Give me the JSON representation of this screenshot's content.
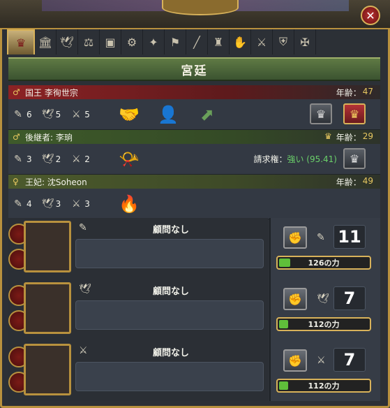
{
  "window": {
    "title": "宮廷",
    "close_icon": "close-icon"
  },
  "tabs": [
    {
      "icon": "crown-icon",
      "active": true
    },
    {
      "icon": "temple-icon"
    },
    {
      "icon": "dove-icon"
    },
    {
      "icon": "goods-icon"
    },
    {
      "icon": "trade-icon"
    },
    {
      "icon": "gears-icon"
    },
    {
      "icon": "idea-bulb-icon"
    },
    {
      "icon": "flag-icon"
    },
    {
      "icon": "rifle-icon"
    },
    {
      "icon": "estates-icon"
    },
    {
      "icon": "prayer-icon"
    },
    {
      "icon": "shield-sword-icon"
    },
    {
      "icon": "coat-of-arms-icon"
    },
    {
      "icon": "swords-cross-icon"
    }
  ],
  "ruler": {
    "symbol": "♂",
    "name": "国王 李徇世宗",
    "age_label": "年齢：",
    "age": "47",
    "adm": "6",
    "dip": "5",
    "mil": "5"
  },
  "heir": {
    "symbol": "♂",
    "name": "後継者: 李珦",
    "age_label": "年齢：",
    "age": "29",
    "adm": "3",
    "dip": "2",
    "mil": "2",
    "claim_label": "請求権：",
    "claim_value": "強い (95.41)"
  },
  "consort": {
    "symbol": "♀",
    "name": "王妃: 沈Soheon",
    "age_label": "年齢：",
    "age": "49",
    "adm": "4",
    "dip": "3",
    "mil": "3"
  },
  "advisors": [
    {
      "type_icon": "scroll-icon",
      "label": "顧問なし"
    },
    {
      "type_icon": "dove-icon",
      "label": "顧問なし"
    },
    {
      "type_icon": "swords-icon",
      "label": "顧問なし"
    }
  ],
  "power": [
    {
      "value": "11",
      "power_label": "126の力",
      "icon": "scroll-icon",
      "fill": 0.12
    },
    {
      "value": "7",
      "power_label": "112の力",
      "icon": "dove-icon",
      "fill": 0.1
    },
    {
      "value": "7",
      "power_label": "112の力",
      "icon": "swords-icon",
      "fill": 0.1
    }
  ],
  "colors": {
    "accent_gold": "#d8b25a",
    "ruler_banner": "#8c2224",
    "heir_banner": "#3e5a2a",
    "claim_green": "#6bd06a"
  }
}
